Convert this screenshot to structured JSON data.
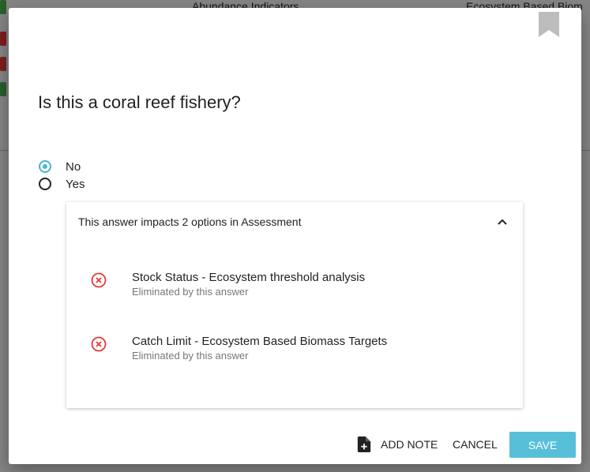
{
  "background": {
    "tab_left": "Abundance Indicators",
    "tab_right": "Ecosystem Based Biom"
  },
  "dialog": {
    "question": "Is this a coral reef fishery?",
    "options": [
      {
        "label": "No",
        "selected": true
      },
      {
        "label": "Yes",
        "selected": false
      }
    ],
    "impact": {
      "header": "This answer impacts 2 options in Assessment",
      "items": [
        {
          "title": "Stock Status - Ecosystem threshold analysis",
          "subtitle": "Eliminated by this answer"
        },
        {
          "title": "Catch Limit - Ecosystem Based Biomass Targets",
          "subtitle": "Eliminated by this answer"
        }
      ]
    },
    "actions": {
      "add_note": "ADD NOTE",
      "cancel": "CANCEL",
      "save": "SAVE"
    }
  },
  "colors": {
    "accent": "#4ab3d0",
    "save_button": "#58bfd9",
    "eliminated": "#e53935"
  },
  "icons": [
    "bookmark-icon",
    "chevron-up-icon",
    "x-circle-icon",
    "note-add-icon"
  ]
}
